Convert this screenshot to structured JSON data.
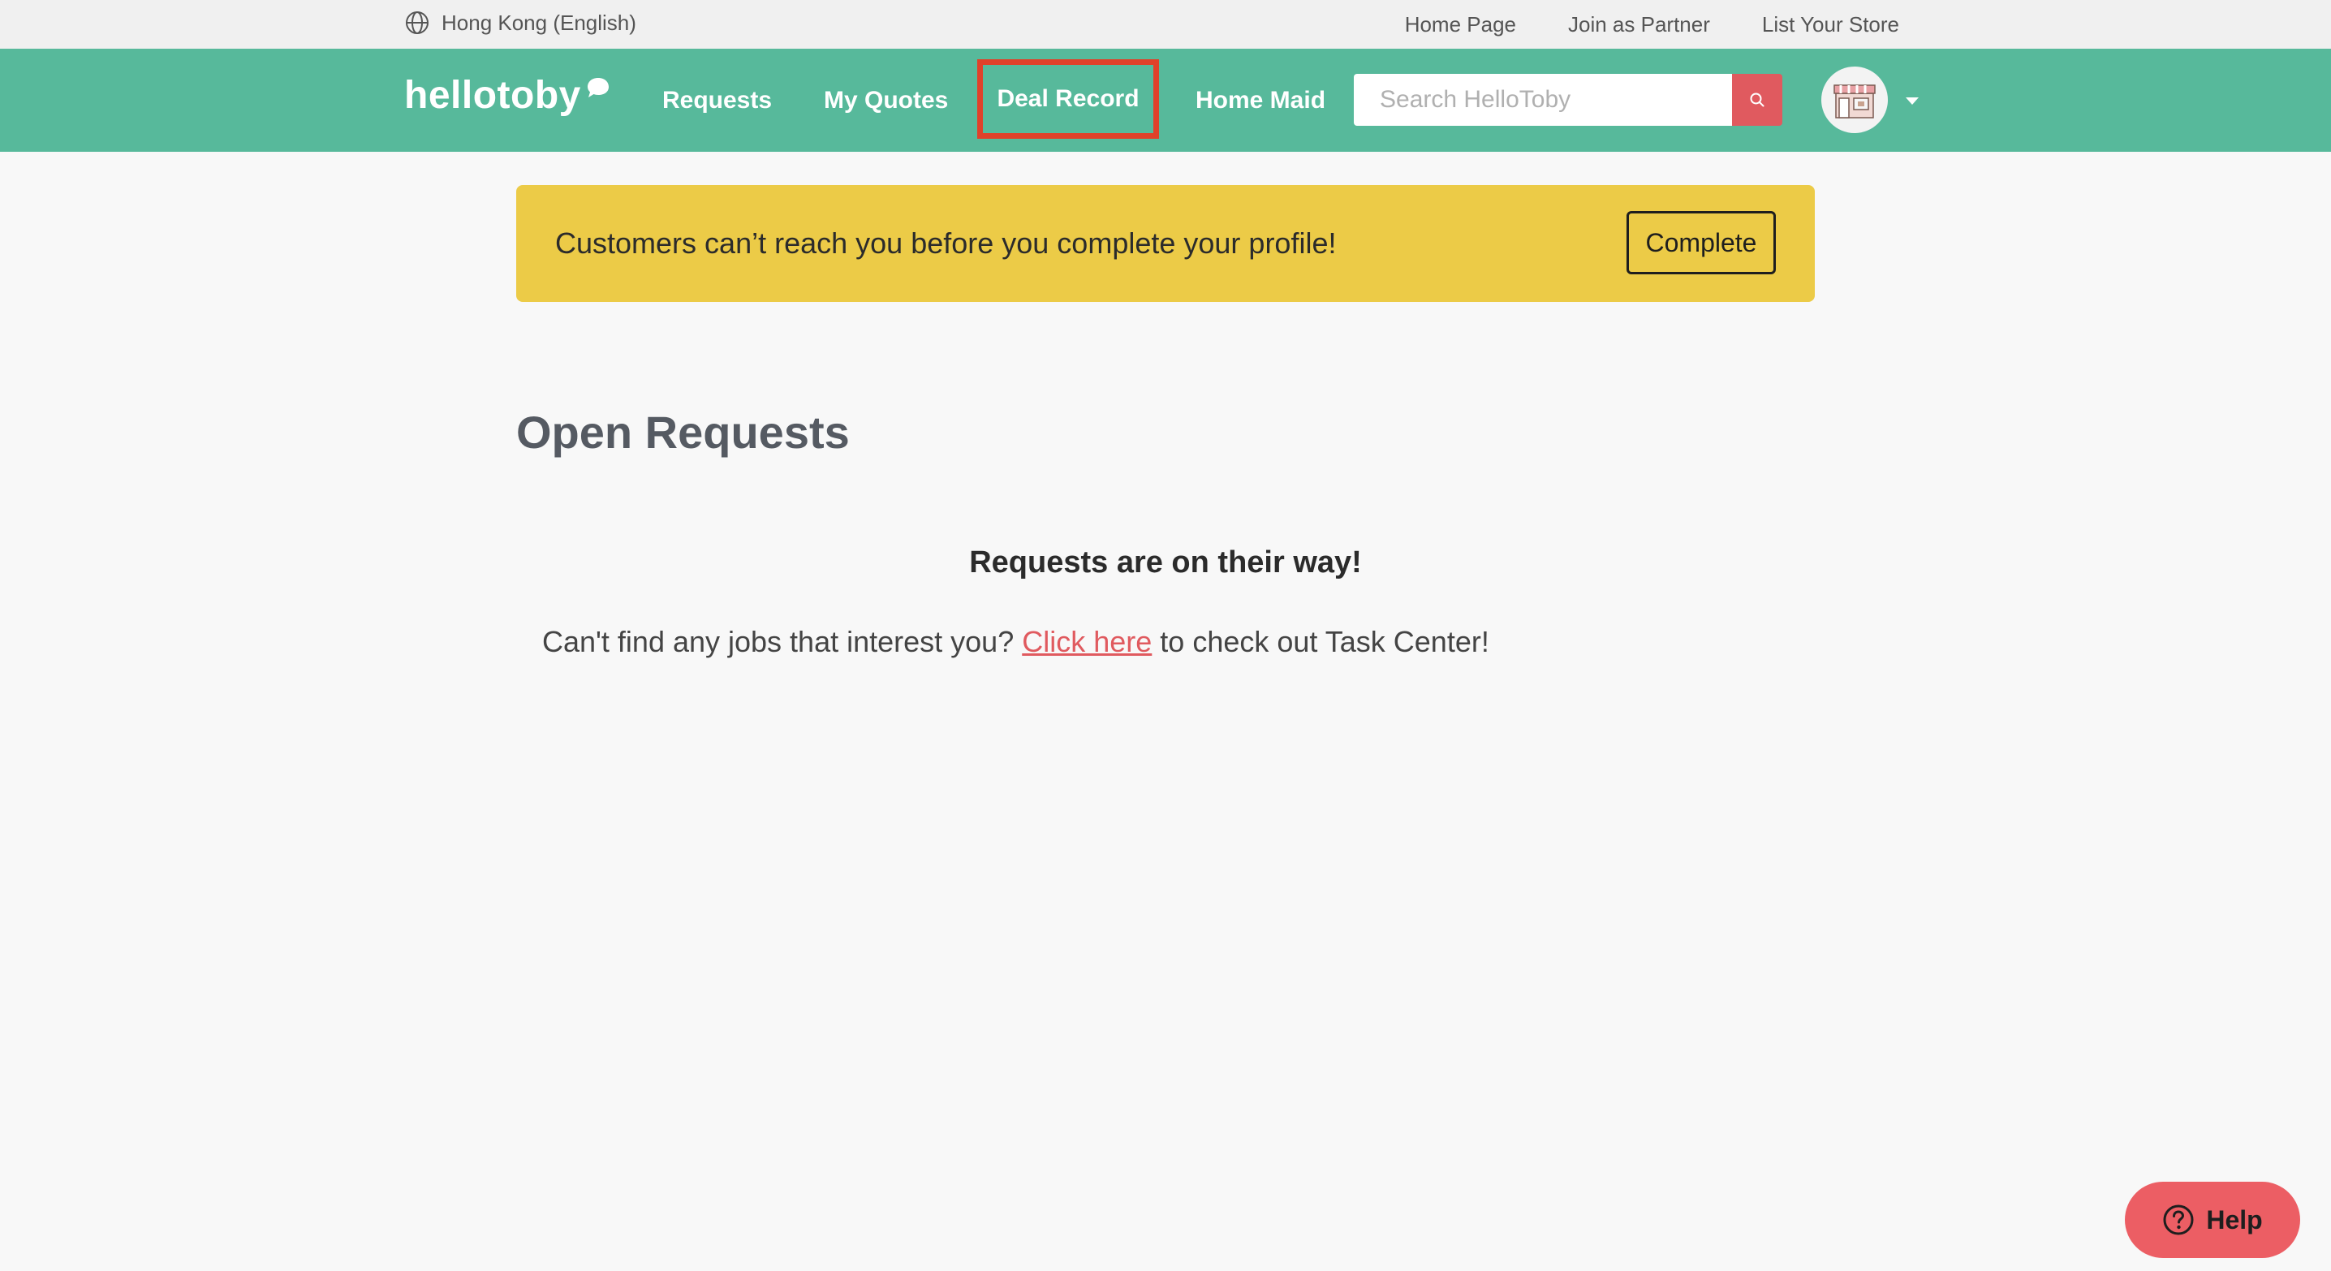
{
  "topbar": {
    "region": "Hong Kong (English)",
    "links": [
      "Home Page",
      "Join as Partner",
      "List Your Store"
    ]
  },
  "navbar": {
    "logo": "hellotoby",
    "items": [
      "Requests",
      "My Quotes",
      "Deal Record",
      "Home Maid"
    ],
    "highlighted_item": "Deal Record",
    "search_placeholder": "Search HelloToby"
  },
  "banner": {
    "message": "Customers can’t reach you before you complete your profile!",
    "button": "Complete"
  },
  "main": {
    "title": "Open Requests",
    "empty_title": "Requests are on their way!",
    "empty_prefix": "Can't find any jobs that interest you? ",
    "empty_link": "Click here",
    "empty_suffix": " to check out Task Center!"
  },
  "help": {
    "label": "Help"
  },
  "colors": {
    "brand_green": "#57b99b",
    "banner_yellow": "#eccb47",
    "accent_red": "#e05a5f",
    "highlight_red": "#e0412a"
  }
}
